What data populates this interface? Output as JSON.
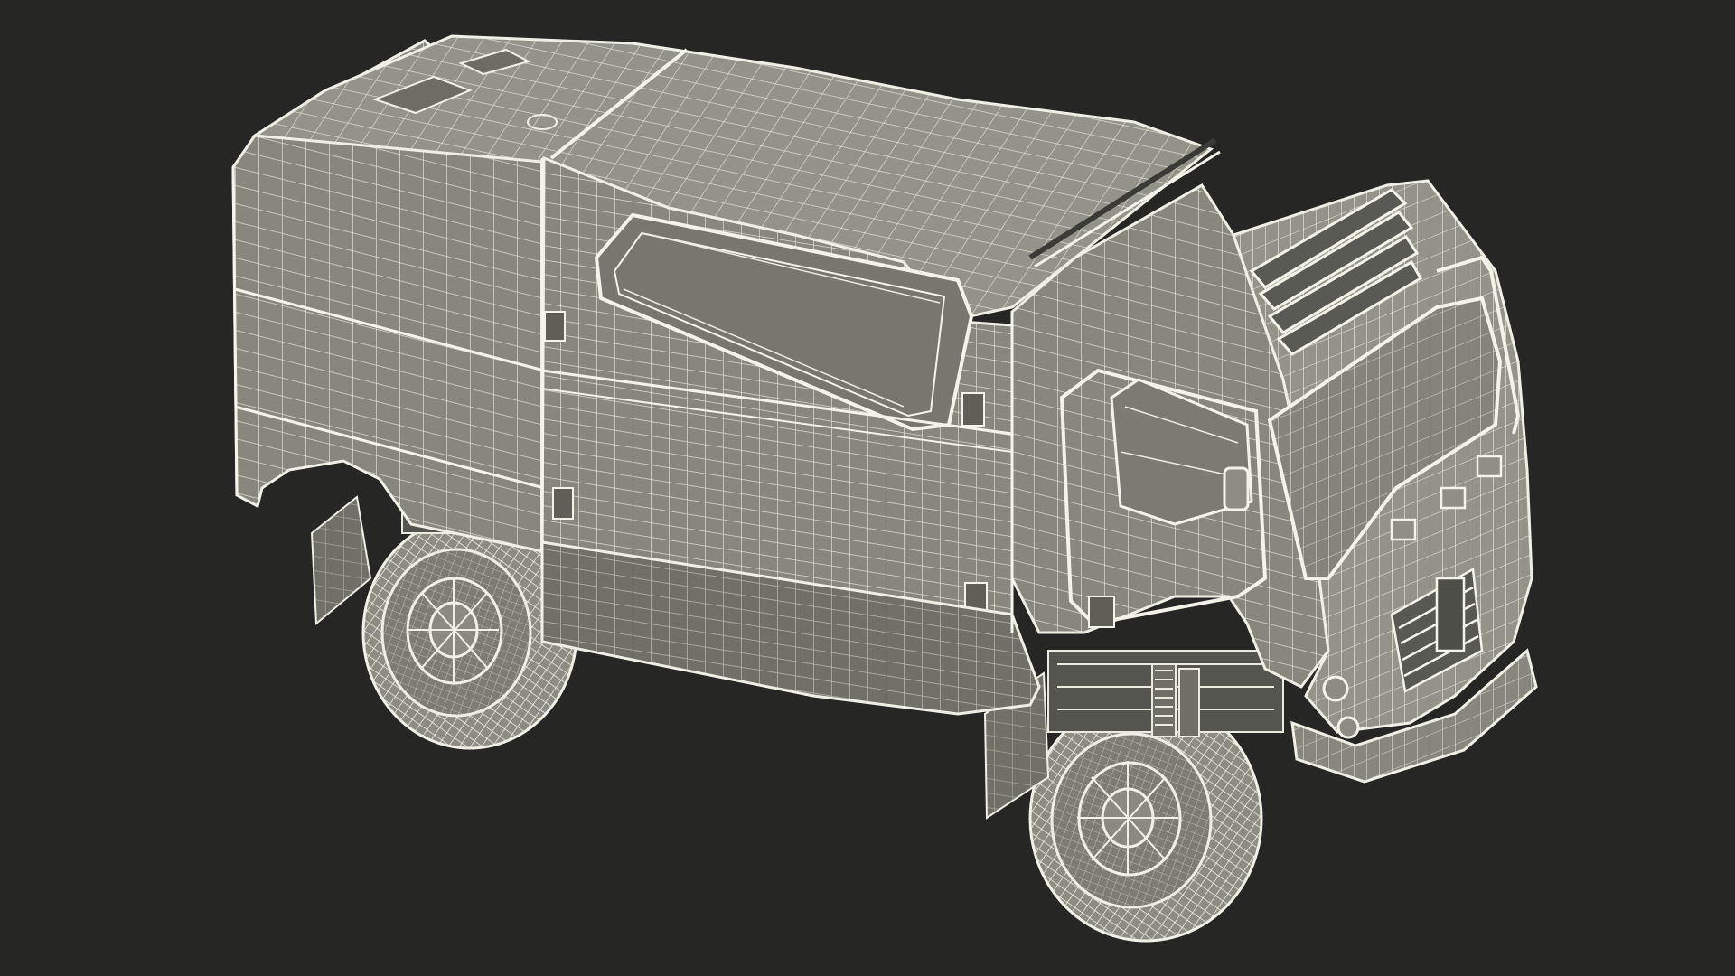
{
  "scene": {
    "subject": "wireframe-rally-truck",
    "colors": {
      "background": "#262625",
      "body_fill": "#87877e",
      "body_fill_light": "#93938a",
      "body_fill_dark": "#707068",
      "wire": "#e9e8dd",
      "wire_dense": "#f3f2e9",
      "dark_gap": "#3a3a36",
      "tire_fill": "#8c8c83",
      "rim_fill": "#7c7c74"
    }
  }
}
